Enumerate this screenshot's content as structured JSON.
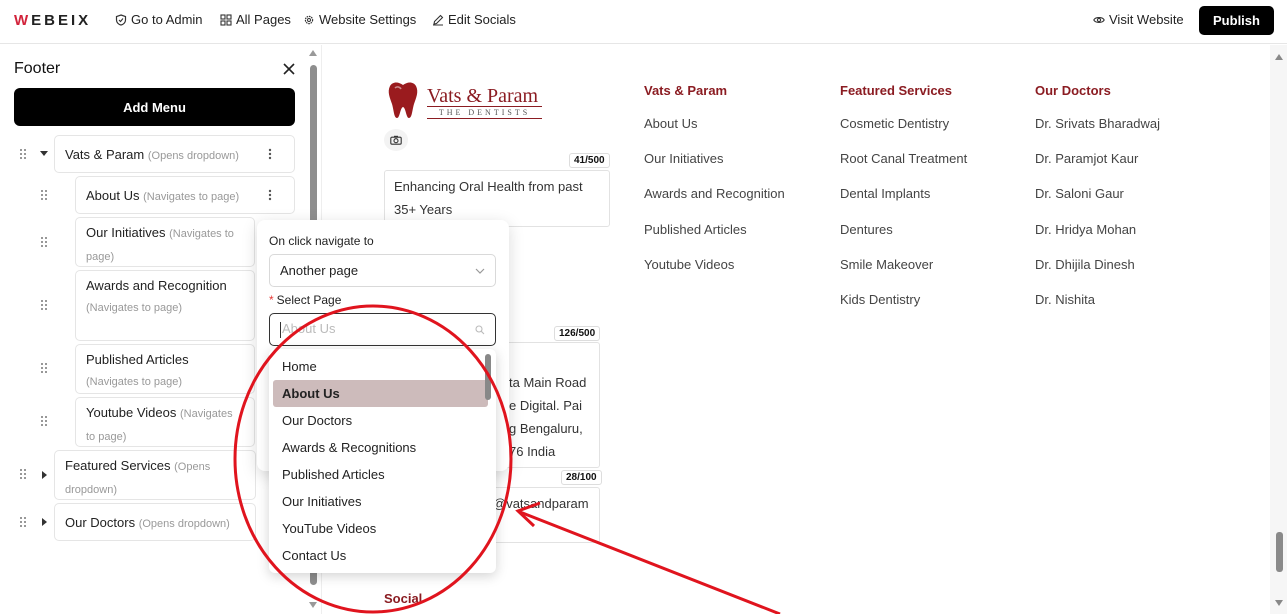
{
  "topbar": {
    "logo": "WEBEIX",
    "logo_initial": "W",
    "logo_rest": "EBEIX",
    "go_to_admin": "Go to Admin",
    "all_pages": "All Pages",
    "website_settings": "Website Settings",
    "edit_socials": "Edit Socials",
    "visit_website": "Visit Website",
    "publish": "Publish"
  },
  "panel": {
    "title": "Footer",
    "add_menu": "Add Menu",
    "items": [
      {
        "label": "Vats & Param",
        "hint": "(Opens dropdown)"
      },
      {
        "label": "About Us",
        "hint": "(Navigates to page)"
      },
      {
        "label": "Our Initiatives",
        "hint": "(Navigates to page)"
      },
      {
        "label": "Awards and Recognition",
        "hint": "(Navigates to page)"
      },
      {
        "label": "Published Articles",
        "hint": "(Navigates to page)"
      },
      {
        "label": "Youtube Videos",
        "hint": "(Navigates to page)"
      },
      {
        "label": "Featured Services",
        "hint": "(Opens dropdown)"
      },
      {
        "label": "Our Doctors",
        "hint": "(Opens dropdown)"
      }
    ]
  },
  "popover": {
    "on_click_label": "On click navigate to",
    "select_value": "Another page",
    "select_page_label": "Select Page",
    "required_mark": "*",
    "search_placeholder": "About Us",
    "options": [
      "Home",
      "About Us",
      "Our Doctors",
      "Awards & Recognitions",
      "Published Articles",
      "Our Initiatives",
      "YouTube Videos",
      "Contact Us"
    ],
    "selected_option": "About Us"
  },
  "preview": {
    "brand_name": "Vats & Param",
    "brand_sub": "THE DENTISTS",
    "tagline_counter": "41/500",
    "tagline": "Enhancing Oral Health from past 35+ Years",
    "address_counter": "126/500",
    "address_lines": [
      "ta Main Road",
      "e Digital. Pai",
      "g Bengaluru,",
      "76 India"
    ],
    "email_counter": "28/100",
    "email_partial": "@vatsandparam",
    "social_heading": "Social",
    "columns": [
      {
        "title": "Vats & Param",
        "items": [
          "About Us",
          "Our Initiatives",
          "Awards and Recognition",
          "Published Articles",
          "Youtube Videos"
        ]
      },
      {
        "title": "Featured Services",
        "items": [
          "Cosmetic Dentistry",
          "Root Canal Treatment",
          "Dental Implants",
          "Dentures",
          "Smile Makeover",
          "Kids Dentistry"
        ]
      },
      {
        "title": "Our Doctors",
        "items": [
          "Dr. Srivats Bharadwaj",
          "Dr. Paramjot Kaur",
          "Dr. Saloni Gaur",
          "Dr. Hridya Mohan",
          "Dr. Dhijila Dinesh",
          "Dr. Nishita"
        ]
      }
    ]
  },
  "colors": {
    "brand": "#8b1c22",
    "selected_option_bg": "#cdbbbb",
    "annotation": "#e0141e"
  }
}
